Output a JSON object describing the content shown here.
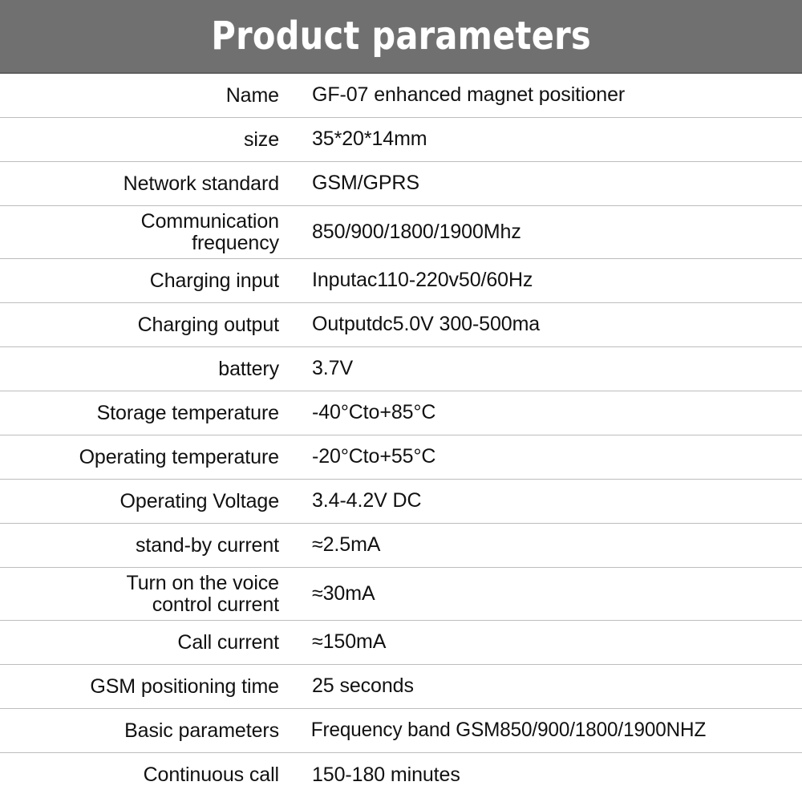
{
  "header": {
    "title": "Product parameters",
    "background_color": "#707070",
    "text_color": "#ffffff"
  },
  "table": {
    "label_column_header": "",
    "value_column_header": "",
    "divider_color": "#1d1d1d",
    "rows": [
      {
        "label": "Name",
        "value": "GF-07 enhanced magnet positioner"
      },
      {
        "label": "size",
        "value": "35*20*14mm"
      },
      {
        "label": "Network standard",
        "value": "GSM/GPRS"
      },
      {
        "label": "Communication\nfrequency",
        "value": "850/900/1800/1900Mhz"
      },
      {
        "label": "Charging input",
        "value": "Inputac110-220v50/60Hz"
      },
      {
        "label": "Charging output",
        "value": "Outputdc5.0V 300-500ma"
      },
      {
        "label": "battery",
        "value": "3.7V"
      },
      {
        "label": "Storage temperature",
        "value": "-40°Cto+85°C"
      },
      {
        "label": "Operating temperature",
        "value": "-20°Cto+55°C"
      },
      {
        "label": "Operating Voltage",
        "value": "3.4-4.2V DC"
      },
      {
        "label": "stand-by current",
        "value": "≈2.5mA"
      },
      {
        "label": "Turn on the voice\ncontrol current",
        "value": "≈30mA"
      },
      {
        "label": "Call current",
        "value": "≈150mA"
      },
      {
        "label": "GSM positioning time",
        "value": "25 seconds"
      },
      {
        "label": "Basic parameters",
        "value": "Frequency band GSM850/900/1800/1900NHZ"
      },
      {
        "label": "Continuous call",
        "value": "150-180 minutes"
      }
    ]
  }
}
